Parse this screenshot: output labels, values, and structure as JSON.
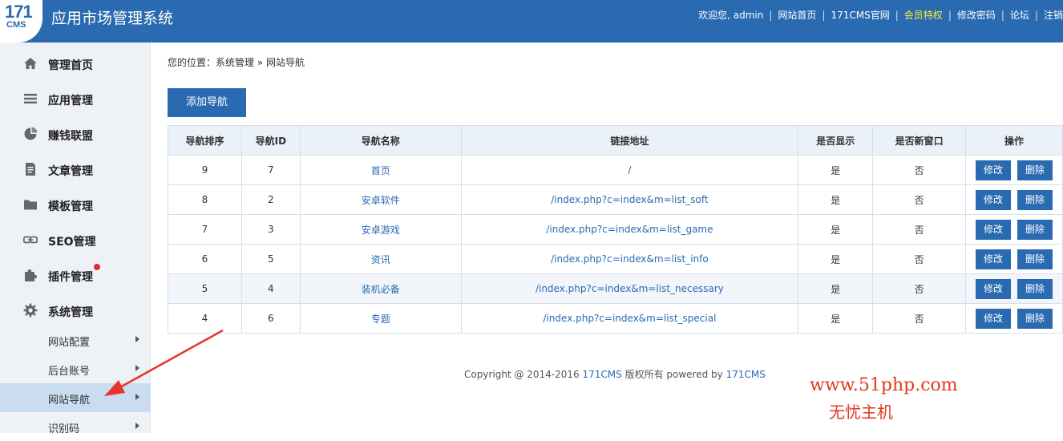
{
  "header": {
    "logo_number": "171",
    "logo_text": "CMS",
    "app_title": "应用市场管理系统",
    "links": [
      {
        "label": "欢迎您, admin",
        "highlight": false
      },
      {
        "label": "网站首页",
        "highlight": false
      },
      {
        "label": "171CMS官网",
        "highlight": false
      },
      {
        "label": "会员特权",
        "highlight": true
      },
      {
        "label": "修改密码",
        "highlight": false
      },
      {
        "label": "论坛",
        "highlight": false
      },
      {
        "label": "注销",
        "highlight": false
      }
    ]
  },
  "sidebar": {
    "items": [
      {
        "label": "管理首页",
        "icon": "home-icon"
      },
      {
        "label": "应用管理",
        "icon": "list-icon"
      },
      {
        "label": "赚钱联盟",
        "icon": "pie-chart-icon"
      },
      {
        "label": "文章管理",
        "icon": "document-icon"
      },
      {
        "label": "模板管理",
        "icon": "folder-icon"
      },
      {
        "label": "SEO管理",
        "icon": "link-icon"
      },
      {
        "label": "插件管理",
        "icon": "puzzle-icon"
      },
      {
        "label": "系统管理",
        "icon": "gear-icon"
      }
    ],
    "sub_items": [
      {
        "label": "网站配置",
        "active": false
      },
      {
        "label": "后台账号",
        "active": false
      },
      {
        "label": "网站导航",
        "active": true
      },
      {
        "label": "识别码",
        "active": false
      }
    ]
  },
  "breadcrumb": "您的位置：系统管理 » 网站导航",
  "add_button": "添加导航",
  "table": {
    "headers": [
      "导航排序",
      "导航ID",
      "导航名称",
      "链接地址",
      "是否显示",
      "是否新窗口",
      "操作"
    ],
    "edit_label": "修改",
    "delete_label": "删除",
    "rows": [
      {
        "order": "9",
        "id": "7",
        "name": "首页",
        "url": "/",
        "show": "是",
        "new_window": "否"
      },
      {
        "order": "8",
        "id": "2",
        "name": "安卓软件",
        "url": "/index.php?c=index&m=list_soft",
        "show": "是",
        "new_window": "否"
      },
      {
        "order": "7",
        "id": "3",
        "name": "安卓游戏",
        "url": "/index.php?c=index&m=list_game",
        "show": "是",
        "new_window": "否"
      },
      {
        "order": "6",
        "id": "5",
        "name": "资讯",
        "url": "/index.php?c=index&m=list_info",
        "show": "是",
        "new_window": "否"
      },
      {
        "order": "5",
        "id": "4",
        "name": "装机必备",
        "url": "/index.php?c=index&m=list_necessary",
        "show": "是",
        "new_window": "否"
      },
      {
        "order": "4",
        "id": "6",
        "name": "专题",
        "url": "/index.php?c=index&m=list_special",
        "show": "是",
        "new_window": "否"
      }
    ]
  },
  "footer": {
    "prefix": "Copyright @ 2014-2016 ",
    "brand1": "171CMS",
    "middle": " 版权所有 powered by ",
    "brand2": "171CMS"
  },
  "watermark": {
    "line1": "www.51php.com",
    "line2": "无忧主机"
  },
  "colors": {
    "primary": "#2a6ab1",
    "highlight": "#f7f03a",
    "watermark": "#e23a1f"
  }
}
